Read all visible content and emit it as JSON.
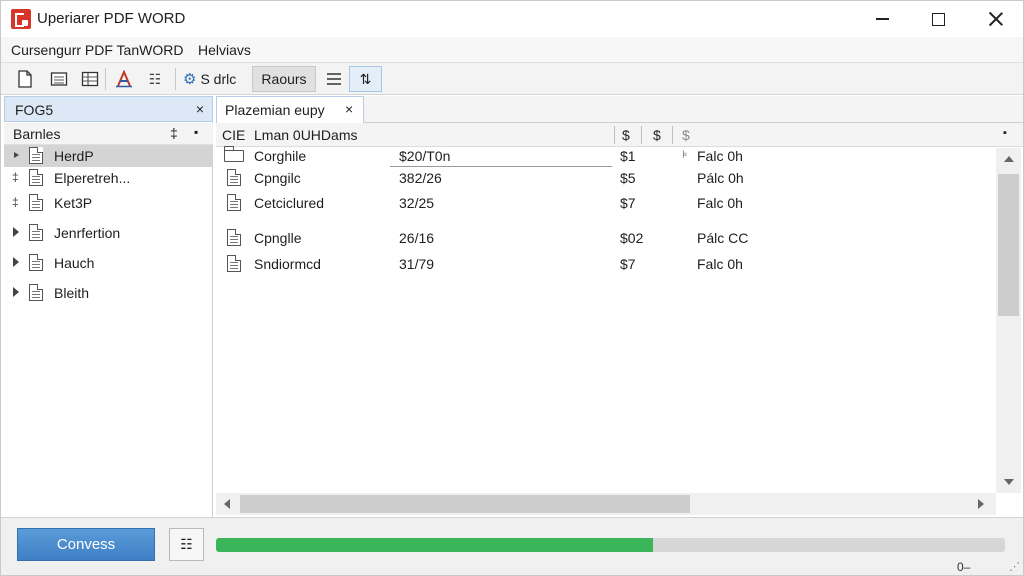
{
  "window": {
    "title": "Uperiarer PDF WORD",
    "colors": {
      "accent": "#3f7fc4",
      "progress": "#3bb559",
      "selection": "#d4d4d4",
      "app_icon": "#d9362b"
    }
  },
  "menu": {
    "items": [
      "Cursengurr PDF TanWORD",
      "Helviavs"
    ]
  },
  "toolbar": {
    "icons": [
      "new-document-icon",
      "open-file-icon",
      "grid-icon",
      "text-format-icon",
      "list-icon",
      "settings-icon",
      "list-view-icon",
      "sort-icon"
    ],
    "list_glyph": "☷",
    "settings_glyph": "⚙",
    "sort_glyph": "⇅",
    "labels": {
      "settings": "S drlc",
      "reports": "Raours"
    }
  },
  "left_panel": {
    "tab_label": "FOG5",
    "close_glyph": "×",
    "header_label": "Barnles",
    "header_icon": "‡",
    "header_icon2": "▪",
    "items": [
      {
        "label": "HerdP",
        "selected": true,
        "expander": "arrow"
      },
      {
        "label": "Elperetreh...",
        "selected": false,
        "expander": "pin"
      },
      {
        "label": "Ket3P",
        "selected": false,
        "expander": "pin"
      },
      {
        "label": "Jenrfertion",
        "selected": false,
        "expander": "arrow"
      },
      {
        "label": "Hauch",
        "selected": false,
        "expander": "arrow"
      },
      {
        "label": "Bleith",
        "selected": false,
        "expander": "arrow"
      }
    ],
    "pin_glyph": "‡"
  },
  "right_panel": {
    "tab_label": "Plazemian eupy",
    "close_glyph": "×",
    "columns": {
      "type": "CIE",
      "name": "Lman 0UHDams",
      "c1": "$",
      "c2": "$",
      "c3": "$",
      "extra": "▪"
    },
    "rows": [
      {
        "name": "Corghile",
        "date": "$20/T0n",
        "size": "$1",
        "status": "Falc 0h",
        "icon": "folder",
        "status_marker": "⊧"
      },
      {
        "name": "Cpngilc",
        "date": "382/26",
        "size": "$5",
        "status": "Pálc 0h",
        "icon": "document",
        "status_marker": ""
      },
      {
        "name": "Cetciclured",
        "date": "32/25",
        "size": "$7",
        "status": "Falc 0h",
        "icon": "document",
        "status_marker": ""
      },
      {
        "name": "Cpnglle",
        "date": "26/16",
        "size": "$02",
        "status": "Pálc CC",
        "icon": "document",
        "status_marker": ""
      },
      {
        "name": "Sndiormcd",
        "date": "31/79",
        "size": "$7",
        "status": "Falc 0h",
        "icon": "document",
        "status_marker": ""
      }
    ]
  },
  "bottom": {
    "convert_label": "Convess",
    "settings_glyph": "☷",
    "progress_fraction": 0.554,
    "status_text": "0–",
    "grip": "⋰"
  }
}
